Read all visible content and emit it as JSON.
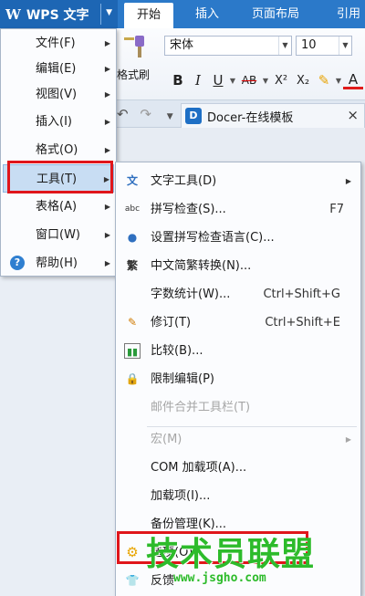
{
  "app": {
    "logo": "W",
    "name": "WPS 文字"
  },
  "ribbon_tabs": [
    "开始",
    "插入",
    "页面布局",
    "引用"
  ],
  "ribbon": {
    "format_painter_label": "格式刷",
    "font_name": "宋体",
    "font_size": "10",
    "bold": "B",
    "italic": "I",
    "underline": "U",
    "strike": "AB",
    "superscript": "X²",
    "subscript": "X₂",
    "font_color": "A"
  },
  "doc_tab": {
    "title": "Docer-在线模板",
    "logo": "D",
    "close": "×"
  },
  "main_menu": [
    {
      "label": "文件(F)",
      "has_sub": true
    },
    {
      "label": "编辑(E)",
      "has_sub": true
    },
    {
      "label": "视图(V)",
      "has_sub": true
    },
    {
      "label": "插入(I)",
      "has_sub": true
    },
    {
      "label": "格式(O)",
      "has_sub": true
    },
    {
      "label": "工具(T)",
      "has_sub": true,
      "highlighted": true
    },
    {
      "label": "表格(A)",
      "has_sub": true
    },
    {
      "label": "窗口(W)",
      "has_sub": true
    },
    {
      "label": "帮助(H)",
      "has_sub": true,
      "icon": "help-icon"
    }
  ],
  "tools_menu": [
    {
      "label": "文字工具(D)",
      "shortcut": "",
      "icon": "text-tool-icon",
      "has_sub": true
    },
    {
      "label": "拼写检查(S)...",
      "shortcut": "F7",
      "icon": "spell-check-icon"
    },
    {
      "label": "设置拼写检查语言(C)...",
      "shortcut": "",
      "icon": "spell-language-icon"
    },
    {
      "label": "中文简繁转换(N)...",
      "shortcut": "",
      "icon": "chinese-convert-icon"
    },
    {
      "label": "字数统计(W)...",
      "shortcut": "Ctrl+Shift+G",
      "icon": ""
    },
    {
      "label": "修订(T)",
      "shortcut": "Ctrl+Shift+E",
      "icon": "track-changes-icon"
    },
    {
      "label": "比较(B)...",
      "shortcut": "",
      "icon": "compare-icon"
    },
    {
      "label": "限制编辑(P)",
      "shortcut": "",
      "icon": "restrict-edit-icon"
    },
    {
      "label": "邮件合并工具栏(T)",
      "shortcut": "",
      "icon": "",
      "disabled": true
    },
    {
      "label": "宏(M)",
      "shortcut": "",
      "icon": "",
      "disabled": true,
      "has_sub": true
    },
    {
      "label": "COM 加载项(A)...",
      "shortcut": "",
      "icon": ""
    },
    {
      "label": "加载项(I)...",
      "shortcut": "",
      "icon": ""
    },
    {
      "label": "备份管理(K)...",
      "shortcut": "",
      "icon": ""
    },
    {
      "label": "选项(O)...",
      "shortcut": "",
      "icon": "gear-icon"
    },
    {
      "label": "反馈",
      "shortcut": "",
      "icon": "shirt-icon"
    }
  ],
  "watermark": {
    "text": "技术员联盟",
    "url": "www.jsgho.com"
  },
  "colors": {
    "title_bar": "#2b79c9",
    "highlight_box": "#e0161b",
    "watermark": "#2dbb2b"
  }
}
